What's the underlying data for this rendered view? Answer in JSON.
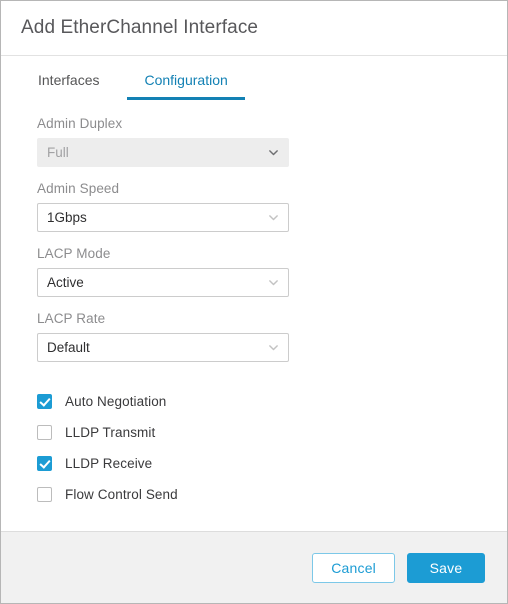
{
  "dialog": {
    "title": "Add EtherChannel Interface"
  },
  "tabs": [
    {
      "label": "Interfaces",
      "active": false
    },
    {
      "label": "Configuration",
      "active": true
    }
  ],
  "form": {
    "fields": [
      {
        "label": "Admin Duplex",
        "value": "Full",
        "disabled": true,
        "name": "admin-duplex"
      },
      {
        "label": "Admin Speed",
        "value": "1Gbps",
        "disabled": false,
        "name": "admin-speed"
      },
      {
        "label": "LACP Mode",
        "value": "Active",
        "disabled": false,
        "name": "lacp-mode"
      },
      {
        "label": "LACP Rate",
        "value": "Default",
        "disabled": false,
        "name": "lacp-rate"
      }
    ],
    "checkboxes": [
      {
        "label": "Auto Negotiation",
        "checked": true,
        "name": "auto-negotiation"
      },
      {
        "label": "LLDP Transmit",
        "checked": false,
        "name": "lldp-transmit"
      },
      {
        "label": "LLDP Receive",
        "checked": true,
        "name": "lldp-receive"
      },
      {
        "label": "Flow Control Send",
        "checked": false,
        "name": "flow-control-send"
      }
    ]
  },
  "footer": {
    "cancel_label": "Cancel",
    "save_label": "Save"
  },
  "icons": {
    "chevron_down": "chevron-down-icon"
  },
  "colors": {
    "accent_blue": "#1c9cd4",
    "tab_active_blue": "#1381b4",
    "footer_bg": "#f1f1f1",
    "disabled_field_bg": "#ededed"
  }
}
